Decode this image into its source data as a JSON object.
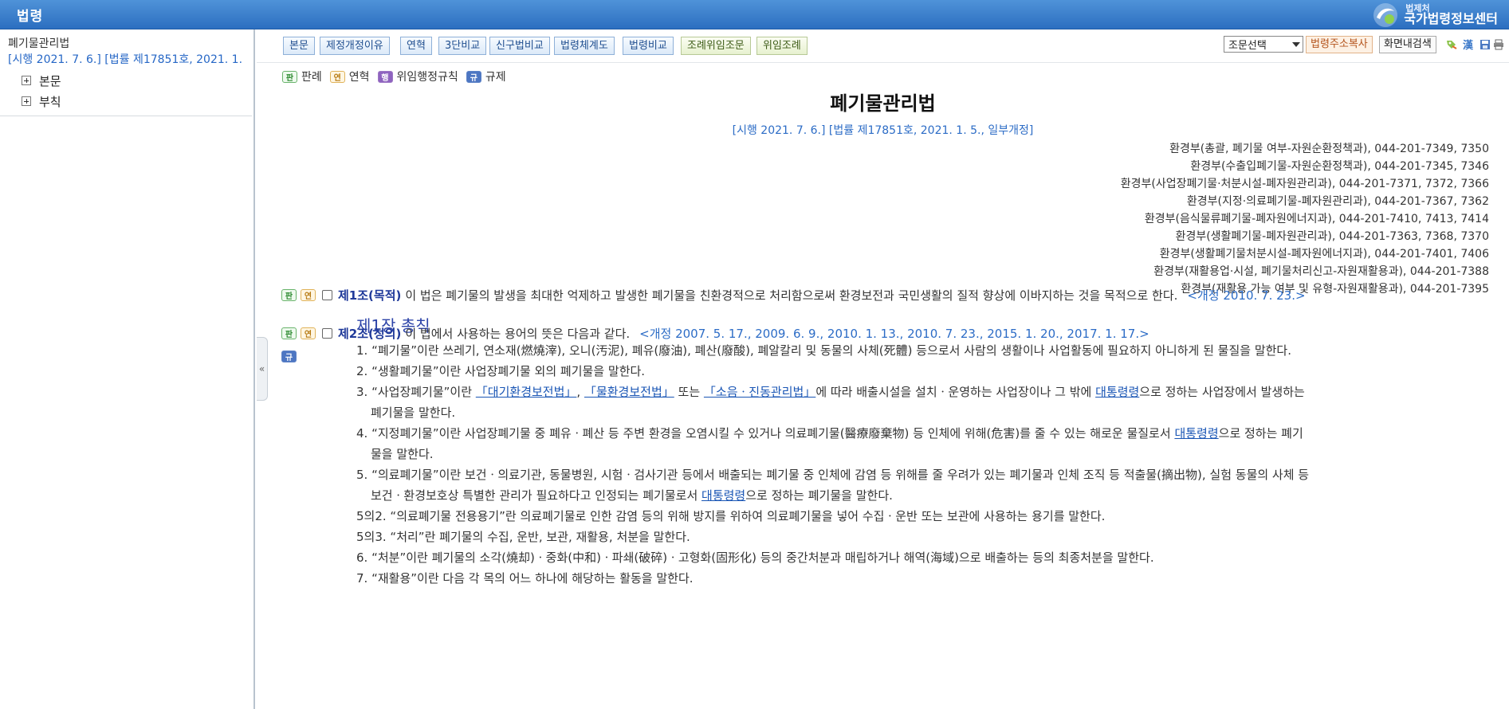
{
  "header": {
    "title": "법령",
    "brand_small": "법제처",
    "brand_name": "국가법령정보센터"
  },
  "left_pane": {
    "title": "폐기물관리법",
    "subtitle": "[시행 2021. 7. 6.] [법률 제17851호, 2021. 1.",
    "nodes": [
      {
        "label": "본문"
      },
      {
        "label": "부칙"
      }
    ]
  },
  "toolbar": {
    "buttons": [
      {
        "label": "본문"
      },
      {
        "label": "제정개정이유"
      },
      {
        "label": "연혁"
      },
      {
        "label": "3단비교"
      },
      {
        "label": "신구법비교"
      },
      {
        "label": "법령체계도"
      },
      {
        "label": "법령비교"
      },
      {
        "label": "조례위임조문"
      },
      {
        "label": "위임조례"
      }
    ],
    "article_select": "조문선택",
    "copy_address": "법령주소복사",
    "screen_search": "화면내검색",
    "icons": [
      "bookmark-icon",
      "hanja-icon",
      "save-icon",
      "print-icon"
    ]
  },
  "legend": {
    "items": [
      {
        "tag": "판",
        "label": "판례"
      },
      {
        "tag": "연",
        "label": "연혁"
      },
      {
        "tag": "행",
        "label": "위임행정규칙"
      },
      {
        "tag": "규",
        "label": "규제"
      }
    ]
  },
  "law": {
    "title": "폐기물관리법",
    "enforce": "[시행 2021. 7. 6.] [법률 제17851호, 2021. 1. 5., 일부개정]",
    "contacts": [
      "환경부(총괄, 폐기물 여부-자원순환정책과), 044-201-7349, 7350",
      "환경부(수출입폐기물-자원순환정책과), 044-201-7345, 7346",
      "환경부(사업장폐기물·처분시설-폐자원관리과), 044-201-7371, 7372, 7366",
      "환경부(지정·의료폐기물-폐자원관리과), 044-201-7367, 7362",
      "환경부(음식물류폐기물-폐자원에너지과), 044-201-7410, 7413, 7414",
      "환경부(생활폐기물-폐자원관리과), 044-201-7363, 7368, 7370",
      "환경부(생활폐기물처분시설-폐자원에너지과), 044-201-7401, 7406",
      "환경부(재활용업·시설, 폐기물처리신고-자원재활용과), 044-201-7388",
      "환경부(재활용 가능 여부 및 유형-자원재활용과), 044-201-7395"
    ],
    "chapter": "제1장 총칙",
    "article1": {
      "head": "제1조(목적)",
      "text": "이 법은 폐기물의 발생을 최대한 억제하고 발생한 폐기물을 친환경적으로 처리함으로써 환경보전과 국민생활의 질적 향상에 이바지하는 것을 목적으로 한다.",
      "amend": "<개정 2010. 7. 23.>"
    },
    "article2": {
      "head": "제2조(정의)",
      "text": "이 법에서 사용하는 용어의 뜻은 다음과 같다.",
      "amend": "<개정 2007. 5. 17., 2009. 6. 9., 2010. 1. 13., 2010. 7. 23., 2015. 1. 20., 2017. 1. 17.>"
    },
    "items": {
      "i1": "1. “폐기물”이란 쓰레기, 연소재(燃燒滓), 오니(汚泥), 폐유(廢油), 폐산(廢酸), 폐알칼리 및 동물의 사체(死體) 등으로서 사람의 생활이나 사업활동에 필요하지 아니하게 된 물질을 말한다.",
      "i2": "2. “생활폐기물”이란 사업장폐기물 외의 폐기물을 말한다.",
      "i3_a": "3. “사업장폐기물”이란 ",
      "i3_l1": "「대기환경보전법」",
      "i3_b": ", ",
      "i3_l2": "「물환경보전법」",
      "i3_c": " 또는 ",
      "i3_l3": "「소음ㆍ진동관리법」",
      "i3_d": "에 따라 배출시설을 설치ㆍ운영하는 사업장이나 그 밖에 ",
      "i3_l4": "대통령령",
      "i3_e": "으로 정하는 사업장에서 발생하는",
      "i3_f": "폐기물을 말한다.",
      "i4_a": "4. “지정폐기물”이란 사업장폐기물 중 폐유ㆍ폐산 등 주변 환경을 오염시킬 수 있거나 의료폐기물(醫療廢棄物) 등 인체에 위해(危害)를 줄 수 있는 해로운 물질로서 ",
      "i4_l": "대통령령",
      "i4_b": "으로 정하는 폐기",
      "i4_c": "물을 말한다.",
      "i5_a": "5. “의료폐기물”이란 보건ㆍ의료기관, 동물병원, 시험ㆍ검사기관 등에서 배출되는 폐기물 중 인체에 감염 등 위해를 줄 우려가 있는 폐기물과 인체 조직 등 적출물(摘出物), 실험 동물의 사체 등",
      "i5_b": "보건ㆍ환경보호상 특별한 관리가 필요하다고 인정되는 폐기물로서 ",
      "i5_l": "대통령령",
      "i5_c": "으로 정하는 폐기물을 말한다.",
      "i5_2": "5의2. “의료폐기물 전용용기”란 의료폐기물로 인한 감염 등의 위해 방지를 위하여 의료폐기물을 넣어 수집ㆍ운반 또는 보관에 사용하는 용기를 말한다.",
      "i5_3": "5의3. “처리”란 폐기물의 수집, 운반, 보관, 재활용, 처분을 말한다.",
      "i6": "6. “처분”이란 폐기물의 소각(燒却)ㆍ중화(中和)ㆍ파쇄(破碎)ㆍ고형화(固形化) 등의 중간처분과 매립하거나 해역(海域)으로 배출하는 등의 최종처분을 말한다.",
      "i7": "7. “재활용”이란 다음 각 목의 어느 하나에 해당하는 활동을 말한다."
    }
  }
}
